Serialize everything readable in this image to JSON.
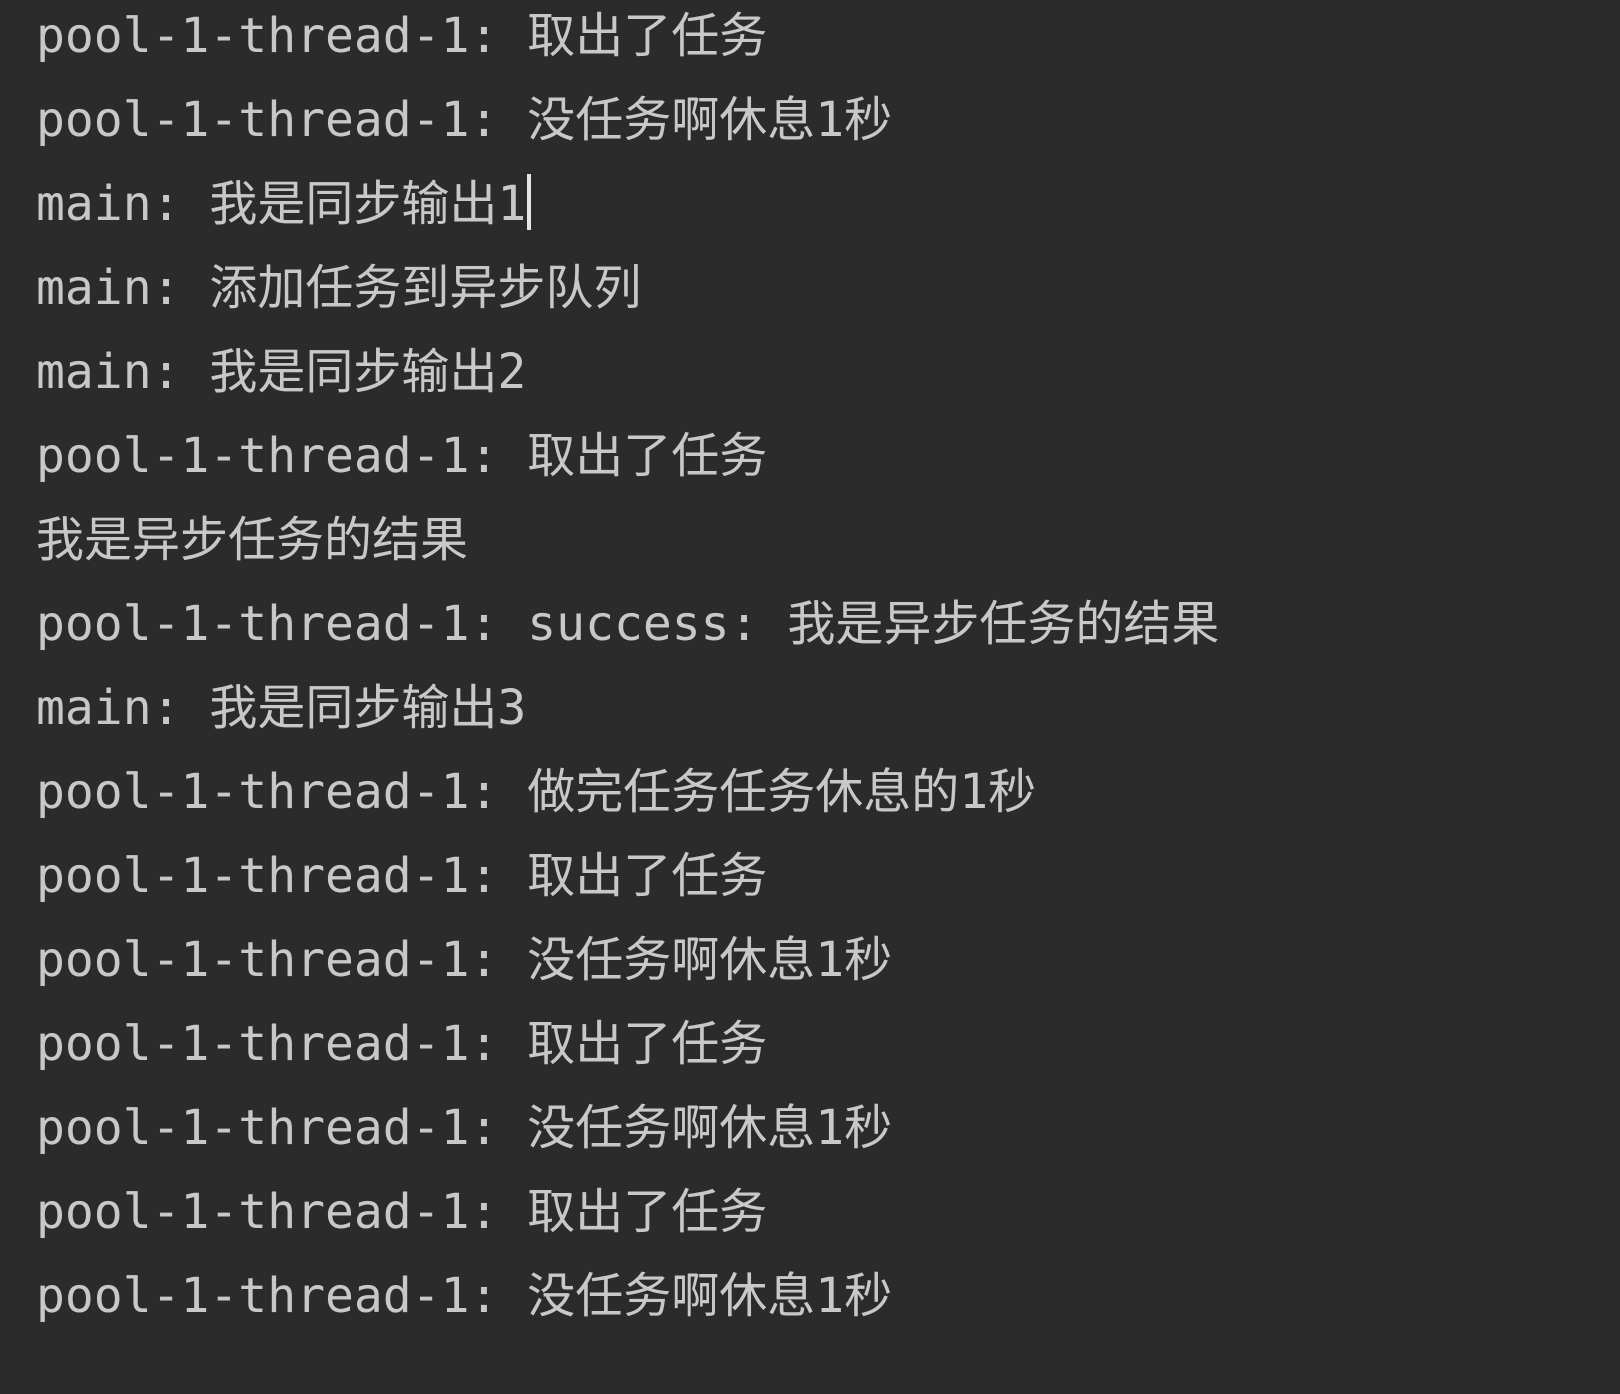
{
  "console": {
    "lines": [
      "pool-1-thread-1: 取出了任务",
      "pool-1-thread-1: 没任务啊休息1秒",
      "main: 我是同步输出1",
      "main: 添加任务到异步队列",
      "main: 我是同步输出2",
      "pool-1-thread-1: 取出了任务",
      "我是异步任务的结果",
      "pool-1-thread-1: success: 我是异步任务的结果",
      "main: 我是同步输出3",
      "pool-1-thread-1: 做完任务任务休息的1秒",
      "pool-1-thread-1: 取出了任务",
      "pool-1-thread-1: 没任务啊休息1秒",
      "pool-1-thread-1: 取出了任务",
      "pool-1-thread-1: 没任务啊休息1秒",
      "pool-1-thread-1: 取出了任务",
      "pool-1-thread-1: 没任务啊休息1秒"
    ]
  }
}
